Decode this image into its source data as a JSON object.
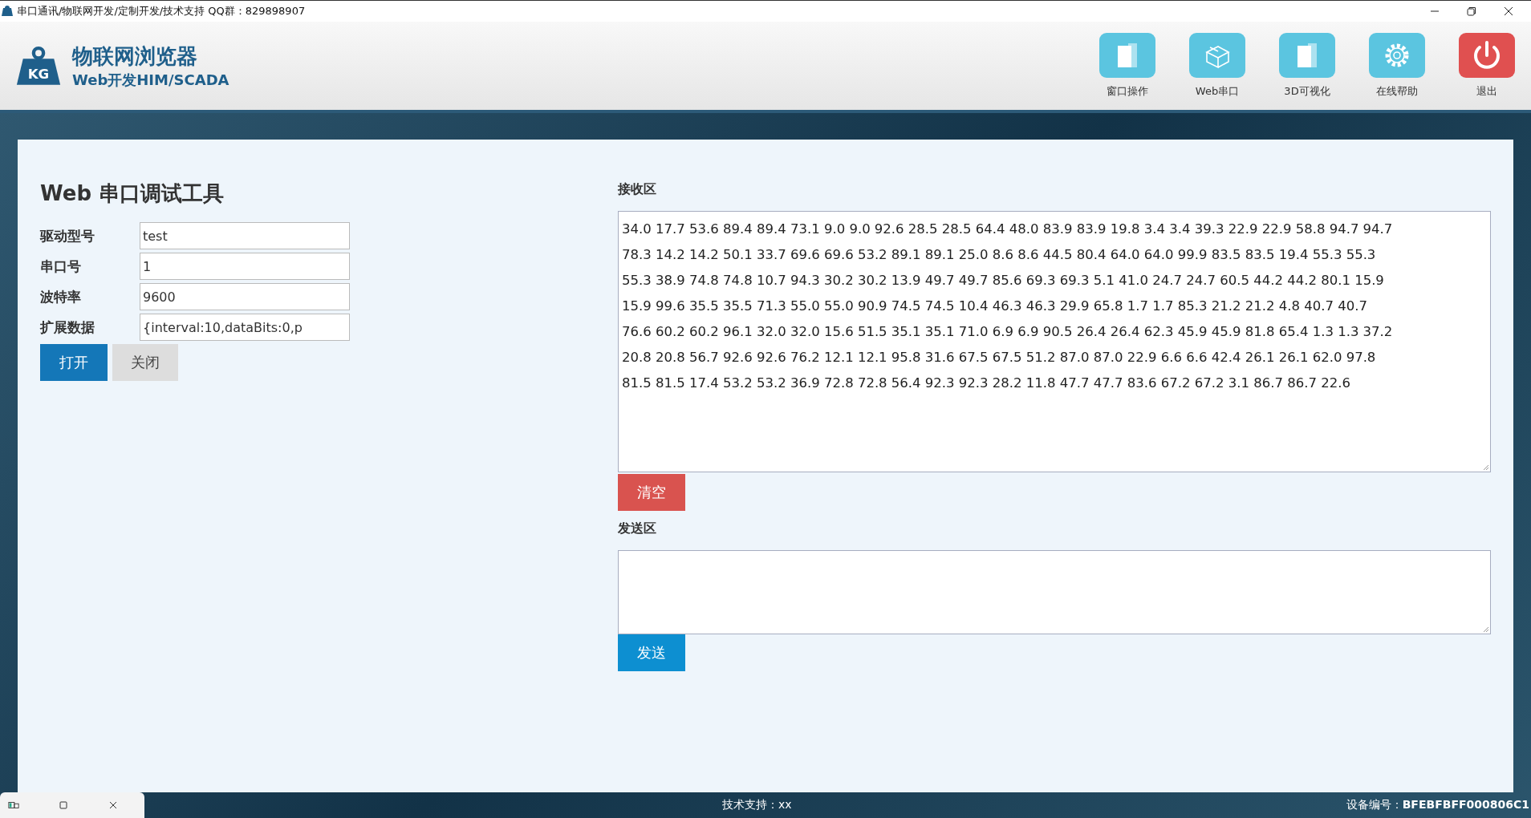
{
  "window": {
    "title": "串口通讯/物联网开发/定制开发/技术支持 QQ群：829898907"
  },
  "header": {
    "brand": "物联网浏览器",
    "subtitle": "Web开发HIM/SCADA",
    "logo_text": "KG",
    "tools": [
      {
        "kind": "pages",
        "label": "窗口操作",
        "color": "#5bc5e0"
      },
      {
        "kind": "box",
        "label": "Web串口",
        "color": "#5bc5e0"
      },
      {
        "kind": "pages",
        "label": "3D可视化",
        "color": "#5bc5e0"
      },
      {
        "kind": "gear",
        "label": "在线帮助",
        "color": "#5bc5e0"
      },
      {
        "kind": "power",
        "label": "退出",
        "color": "#e05050"
      }
    ]
  },
  "tool_panel": {
    "title": "Web 串口调试工具",
    "fields": [
      {
        "label": "驱动型号",
        "value": "test"
      },
      {
        "label": "串口号",
        "value": "1"
      },
      {
        "label": "波特率",
        "value": "9600"
      },
      {
        "label": "扩展数据",
        "value": "{interval:10,dataBits:0,p"
      }
    ],
    "buttons": [
      {
        "kind": "primary",
        "label": "打开"
      },
      {
        "kind": "default",
        "label": "关闭"
      }
    ]
  },
  "receive": {
    "heading": "接收区",
    "lines": [
      "34.0 17.7 53.6 89.4 89.4 73.1 9.0 9.0 92.6 28.5 28.5 64.4 48.0 83.9 83.9 19.8 3.4 3.4 39.3 22.9 22.9 58.8 94.7 94.7",
      "78.3 14.2 14.2 50.1 33.7 69.6 69.6 53.2 89.1 89.1 25.0 8.6 8.6 44.5 80.4 64.0 64.0 99.9 83.5 83.5 19.4 55.3 55.3",
      "55.3 38.9 74.8 74.8 10.7 94.3 30.2 30.2 13.9 49.7 49.7 85.6 69.3 69.3 5.1 41.0 24.7 24.7 60.5 44.2 44.2 80.1 15.9",
      "15.9 99.6 35.5 35.5 71.3 55.0 55.0 90.9 74.5 74.5 10.4 46.3 46.3 29.9 65.8 1.7 1.7 85.3 21.2 21.2 4.8 40.7 40.7",
      "76.6 60.2 60.2 96.1 32.0 32.0 15.6 51.5 35.1 35.1 71.0 6.9 6.9 90.5 26.4 26.4 62.3 45.9 45.9 81.8 65.4 1.3 1.3 37.2",
      "20.8 20.8 56.7 92.6 92.6 76.2 12.1 12.1 95.8 31.6 67.5 67.5 51.2 87.0 87.0 22.9 6.6 6.6 42.4 26.1 26.1 62.0 97.8",
      "81.5 81.5 17.4 53.2 53.2 36.9 72.8 72.8 56.4 92.3 92.3 28.2 11.8 47.7 47.7 83.6 67.2 67.2 3.1 86.7 86.7 22.6"
    ],
    "button": "清空"
  },
  "send": {
    "heading": "发送区",
    "button": "发送"
  },
  "status_bar": {
    "support": "技术支持：xx",
    "device": "设备编号：**BFEBFBFF000806C1**"
  }
}
